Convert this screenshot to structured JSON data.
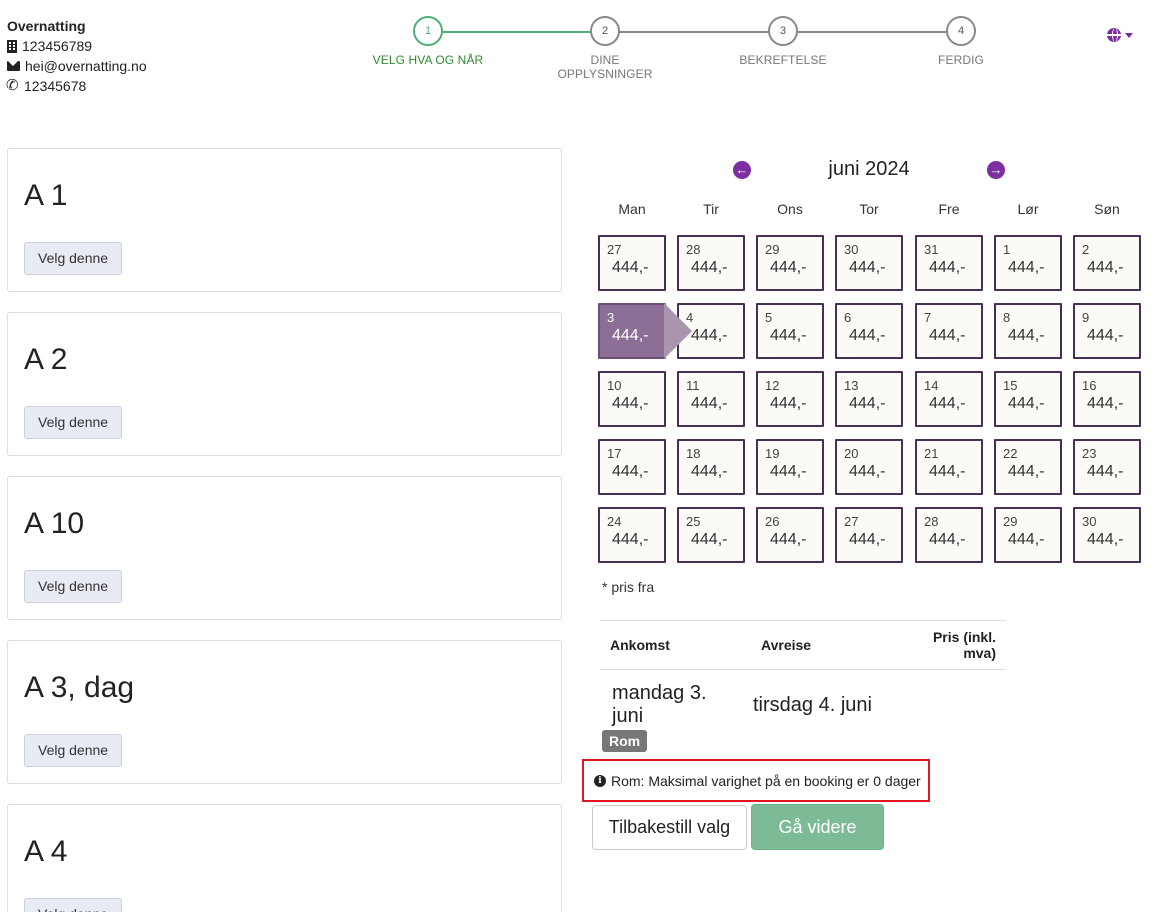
{
  "contact": {
    "name": "Overnatting",
    "org_number": "123456789",
    "email": "hei@overnatting.no",
    "phone": "12345678"
  },
  "stepper": {
    "steps": [
      {
        "number": "1",
        "label": "VELG HVA OG NÅR",
        "active": true
      },
      {
        "number": "2",
        "label": "DINE OPPLYSNINGER",
        "active": false
      },
      {
        "number": "3",
        "label": "BEKREFTELSE",
        "active": false
      },
      {
        "number": "4",
        "label": "FERDIG",
        "active": false
      }
    ]
  },
  "colors": {
    "accent": "#7b2fa0",
    "active_step": "#4caf76",
    "selected_day": "#8c6e96",
    "alert_border": "#e0161c",
    "next_button": "#7dbb96"
  },
  "rooms": [
    {
      "name": "A 1",
      "button": "Velg denne"
    },
    {
      "name": "A 2",
      "button": "Velg denne"
    },
    {
      "name": "A 10",
      "button": "Velg denne"
    },
    {
      "name": "A 3, dag",
      "button": "Velg denne"
    },
    {
      "name": "A 4",
      "button": "Velg denne"
    }
  ],
  "calendar": {
    "month_label": "juni 2024",
    "weekdays": [
      "Man",
      "Tir",
      "Ons",
      "Tor",
      "Fre",
      "Lør",
      "Søn"
    ],
    "days": [
      {
        "num": "27",
        "price": "444,-"
      },
      {
        "num": "28",
        "price": "444,-"
      },
      {
        "num": "29",
        "price": "444,-"
      },
      {
        "num": "30",
        "price": "444,-"
      },
      {
        "num": "31",
        "price": "444,-"
      },
      {
        "num": "1",
        "price": "444,-"
      },
      {
        "num": "2",
        "price": "444,-"
      },
      {
        "num": "3",
        "price": "444,-",
        "selected": true
      },
      {
        "num": "4",
        "price": "444,-"
      },
      {
        "num": "5",
        "price": "444,-"
      },
      {
        "num": "6",
        "price": "444,-"
      },
      {
        "num": "7",
        "price": "444,-"
      },
      {
        "num": "8",
        "price": "444,-"
      },
      {
        "num": "9",
        "price": "444,-"
      },
      {
        "num": "10",
        "price": "444,-"
      },
      {
        "num": "11",
        "price": "444,-"
      },
      {
        "num": "12",
        "price": "444,-"
      },
      {
        "num": "13",
        "price": "444,-"
      },
      {
        "num": "14",
        "price": "444,-"
      },
      {
        "num": "15",
        "price": "444,-"
      },
      {
        "num": "16",
        "price": "444,-"
      },
      {
        "num": "17",
        "price": "444,-"
      },
      {
        "num": "18",
        "price": "444,-"
      },
      {
        "num": "19",
        "price": "444,-"
      },
      {
        "num": "20",
        "price": "444,-"
      },
      {
        "num": "21",
        "price": "444,-"
      },
      {
        "num": "22",
        "price": "444,-"
      },
      {
        "num": "23",
        "price": "444,-"
      },
      {
        "num": "24",
        "price": "444,-"
      },
      {
        "num": "25",
        "price": "444,-"
      },
      {
        "num": "26",
        "price": "444,-"
      },
      {
        "num": "27",
        "price": "444,-"
      },
      {
        "num": "28",
        "price": "444,-"
      },
      {
        "num": "29",
        "price": "444,-"
      },
      {
        "num": "30",
        "price": "444,-"
      }
    ],
    "price_note": "* pris fra"
  },
  "summary": {
    "headers": [
      "Ankomst",
      "Avreise",
      "Pris (inkl. mva)"
    ],
    "arrival": "mandag 3. juni",
    "departure": "tirsdag 4. juni",
    "price": ""
  },
  "badge": "Rom",
  "alert": "Rom: Maksimal varighet på en booking er 0 dager",
  "buttons": {
    "reset": "Tilbakestill valg",
    "next": "Gå videre"
  }
}
